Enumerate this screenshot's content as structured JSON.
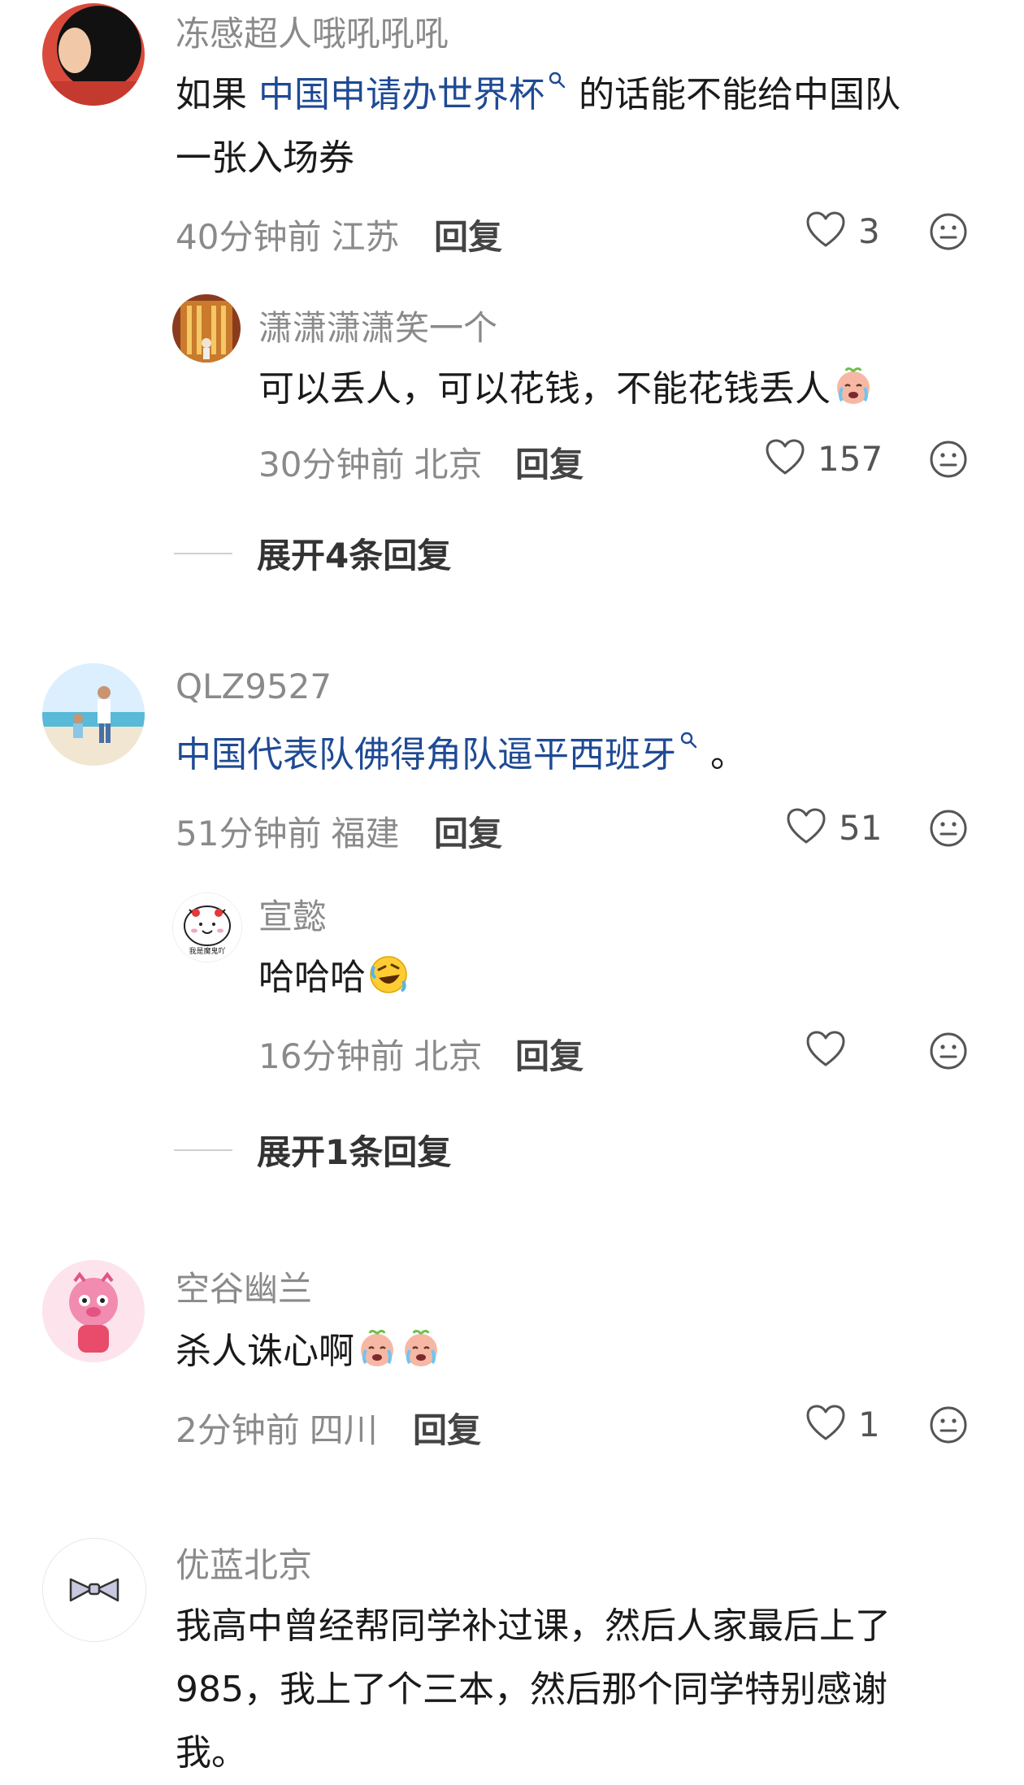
{
  "comments": [
    {
      "username": "冻感超人哦吼吼吼",
      "text_pre": "如果",
      "link": "中国申请办世界杯",
      "text_post": "的话能不能给中国队",
      "text_line2": "一张入场券",
      "time": "40分钟前",
      "location": "江苏",
      "reply": "回复",
      "likes": "3",
      "reply_item": {
        "username": "潇潇潇潇笑一个",
        "text": "可以丢人，可以花钱，不能花钱丢人",
        "time": "30分钟前",
        "location": "北京",
        "reply": "回复",
        "likes": "157"
      },
      "expand": "展开4条回复"
    },
    {
      "username": "QLZ9527",
      "link": "中国代表队佛得角队逼平西班牙",
      "text_post": "。",
      "time": "51分钟前",
      "location": "福建",
      "reply": "回复",
      "likes": "51",
      "reply_item": {
        "username": "宣懿",
        "avatar_text": "我是魔鬼吖",
        "text": "哈哈哈",
        "time": "16分钟前",
        "location": "北京",
        "reply": "回复",
        "likes": ""
      },
      "expand": "展开1条回复"
    },
    {
      "username": "空谷幽兰",
      "text": "杀人诛心啊",
      "time": "2分钟前",
      "location": "四川",
      "reply": "回复",
      "likes": "1"
    },
    {
      "username": "优蓝北京",
      "text_line1": "我高中曾经帮同学补过课，然后人家最后上了",
      "text_line2": "985，我上了个三本，然后那个同学特别感谢",
      "text_line3": "我。"
    }
  ],
  "icons": {
    "like": "heart-outline-icon",
    "dislike": "neutral-face-icon",
    "search": "search-icon"
  },
  "colors": {
    "link": "#1f4a94",
    "secondary_text": "#8a8a8a"
  }
}
